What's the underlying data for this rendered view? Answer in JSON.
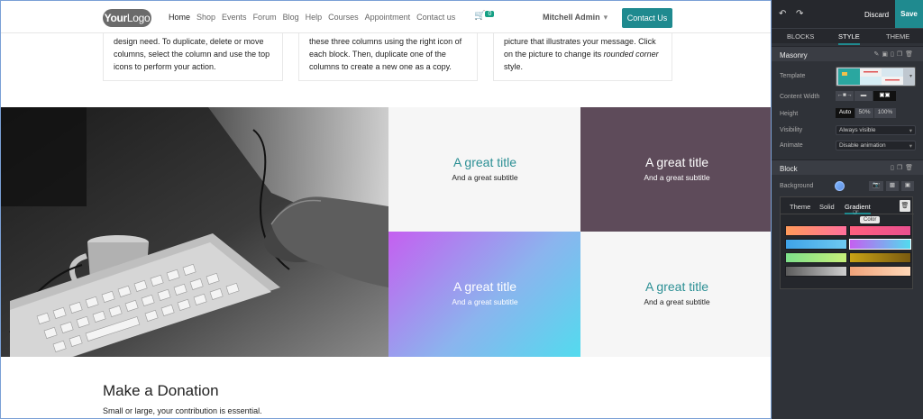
{
  "navbar": {
    "logo": {
      "bold": "Your",
      "rest": "Logo"
    },
    "menu": [
      "Home",
      "Shop",
      "Events",
      "Forum",
      "Blog",
      "Help",
      "Courses",
      "Appointment",
      "Contact us"
    ],
    "cart_count": "0",
    "user": "Mitchell Admin",
    "contact_button": "Contact Us"
  },
  "columns": [
    {
      "text": "design need. To duplicate, delete or move columns, select the column and use the top icons to perform your action."
    },
    {
      "text": "these three columns using the right icon of each block. Then, duplicate one of the columns to create a new one as a copy."
    },
    {
      "text_before": "picture that illustrates your message. Click on the picture to change its ",
      "text_em": "rounded corner",
      "text_after": " style."
    }
  ],
  "masonry": {
    "tiles": [
      {
        "title": "A great title",
        "subtitle": "And a great subtitle"
      },
      {
        "title": "A great title",
        "subtitle": "And a great subtitle"
      },
      {
        "title": "A great title",
        "subtitle": "And a great subtitle"
      },
      {
        "title": "A great title",
        "subtitle": "And a great subtitle"
      }
    ]
  },
  "donation": {
    "title": "Make a Donation",
    "subtitle": "Small or large, your contribution is essential."
  },
  "panel": {
    "discard": "Discard",
    "save": "Save",
    "tabs": [
      "BLOCKS",
      "STYLE",
      "THEME"
    ],
    "masonry_section": {
      "title": "Masonry",
      "template_label": "Template",
      "content_width_label": "Content Width",
      "height_label": "Height",
      "height_options": [
        "Auto",
        "50%",
        "100%"
      ],
      "visibility_label": "Visibility",
      "visibility_value": "Always visible",
      "animate_label": "Animate",
      "animate_value": "Disable animation"
    },
    "block_section": {
      "title": "Block",
      "background_label": "Background"
    },
    "color_popup": {
      "tabs": [
        "Theme",
        "Solid",
        "Gradient"
      ],
      "tooltip": "Color"
    }
  },
  "colors": {
    "accent": "#1f8a8f",
    "panel_bg": "#2f3238",
    "tile_dark": "#5e4b5a",
    "title_teal": "#2b8f94",
    "gradient_stops": [
      "#c55ff0",
      "#8bb4ee",
      "#52dbee"
    ]
  }
}
